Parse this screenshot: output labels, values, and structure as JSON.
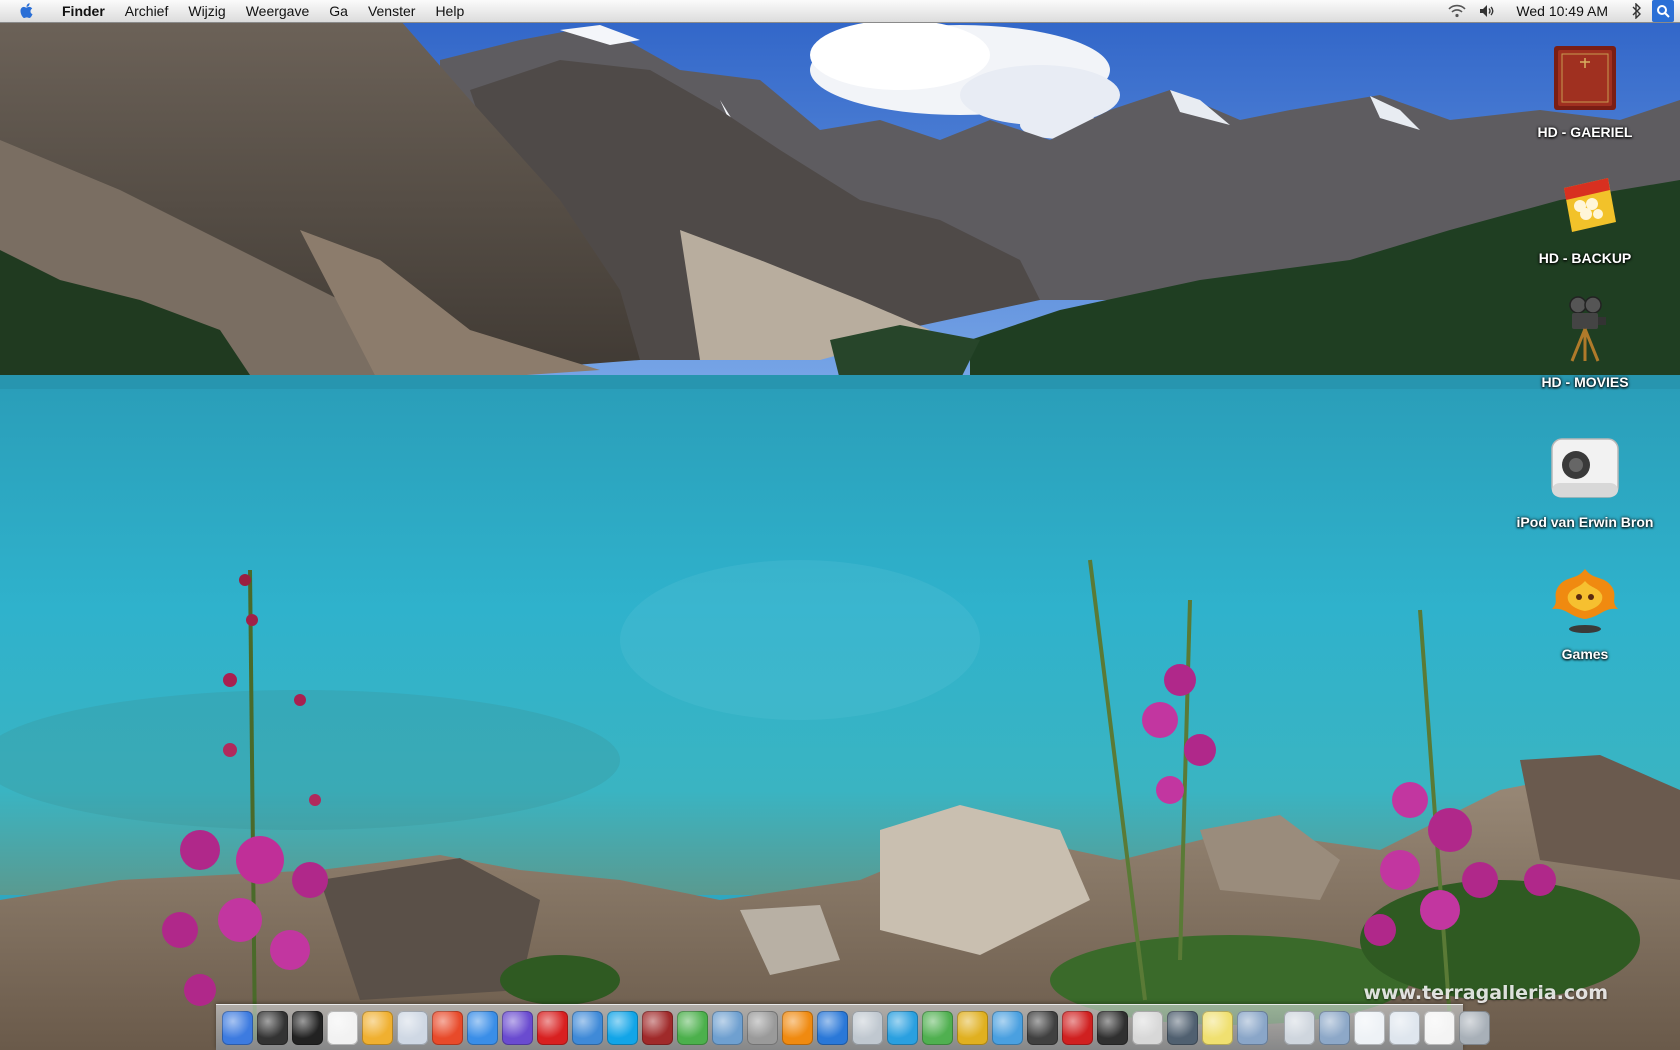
{
  "menubar": {
    "apple_icon": "apple-logo-icon",
    "items": [
      "Finder",
      "Archief",
      "Wijzig",
      "Weergave",
      "Ga",
      "Venster",
      "Help"
    ],
    "status_icons": [
      "wifi-icon",
      "volume-icon",
      "bluetooth-icon"
    ],
    "clock": "Wed 10:49 AM",
    "spotlight_icon": "spotlight-search-icon"
  },
  "desktop_icons": [
    {
      "label": "HD - GAERIEL",
      "icon": "hard-drive-book-icon"
    },
    {
      "label": "HD - BACKUP",
      "icon": "hard-drive-popcorn-icon"
    },
    {
      "label": "HD - MOVIES",
      "icon": "film-camera-icon"
    },
    {
      "label": "iPod van Erwin Bron",
      "icon": "ipod-speaker-icon"
    },
    {
      "label": "Games",
      "icon": "fire-character-icon"
    }
  ],
  "watermark": "www.terragalleria.com",
  "dock": {
    "apps": [
      {
        "name": "finder-icon",
        "color": "#3d7be0"
      },
      {
        "name": "dashboard-icon",
        "color": "#333333"
      },
      {
        "name": "terminal-icon",
        "color": "#222222"
      },
      {
        "name": "x11-icon",
        "color": "#f2f2f2"
      },
      {
        "name": "grab-icon",
        "color": "#f0b030"
      },
      {
        "name": "mail-icon",
        "color": "#cfd8e4"
      },
      {
        "name": "popcorn-icon",
        "color": "#e84a2a"
      },
      {
        "name": "safari-icon",
        "color": "#3a8ee8"
      },
      {
        "name": "ichat-icon",
        "color": "#6a4bd0"
      },
      {
        "name": "magnet-icon",
        "color": "#d82020"
      },
      {
        "name": "network-icon",
        "color": "#3f8ad8"
      },
      {
        "name": "skype-icon",
        "color": "#12a5e8"
      },
      {
        "name": "books-icon",
        "color": "#a02a2a"
      },
      {
        "name": "itunes-icon",
        "color": "#4cb04c"
      },
      {
        "name": "iphoto-icon",
        "color": "#6fa0d0"
      },
      {
        "name": "calculator-icon",
        "color": "#9a9a9a"
      },
      {
        "name": "vlc-icon",
        "color": "#f08a10"
      },
      {
        "name": "quicktime-icon",
        "color": "#2a78d8"
      },
      {
        "name": "cd-icon",
        "color": "#c0c8d0"
      },
      {
        "name": "logo-w-icon",
        "color": "#2aa0e0"
      },
      {
        "name": "mahjong-icon",
        "color": "#50b050"
      },
      {
        "name": "pinball-icon",
        "color": "#e0b020"
      },
      {
        "name": "feather-icon",
        "color": "#4aa0e0"
      },
      {
        "name": "photo-icon",
        "color": "#404040"
      },
      {
        "name": "red-app-icon",
        "color": "#d02020"
      },
      {
        "name": "camera-icon",
        "color": "#303030"
      },
      {
        "name": "preview-icon",
        "color": "#d8d8d8"
      },
      {
        "name": "printer-icon",
        "color": "#506070"
      },
      {
        "name": "lightbulb-icon",
        "color": "#f0e070"
      },
      {
        "name": "image-tool-icon",
        "color": "#8aa6c8"
      }
    ],
    "stacks": [
      {
        "name": "downloads-stack-icon",
        "color": "#cfd6de"
      },
      {
        "name": "documents-stack-icon",
        "color": "#8da8c8"
      },
      {
        "name": "folder-stack-icon",
        "color": "#eef2f6"
      },
      {
        "name": "applications-stack-icon",
        "color": "#dfe6ee"
      },
      {
        "name": "window-stack-icon",
        "color": "#f4f4f4"
      },
      {
        "name": "trash-icon",
        "color": "#a8b0b8"
      }
    ]
  }
}
